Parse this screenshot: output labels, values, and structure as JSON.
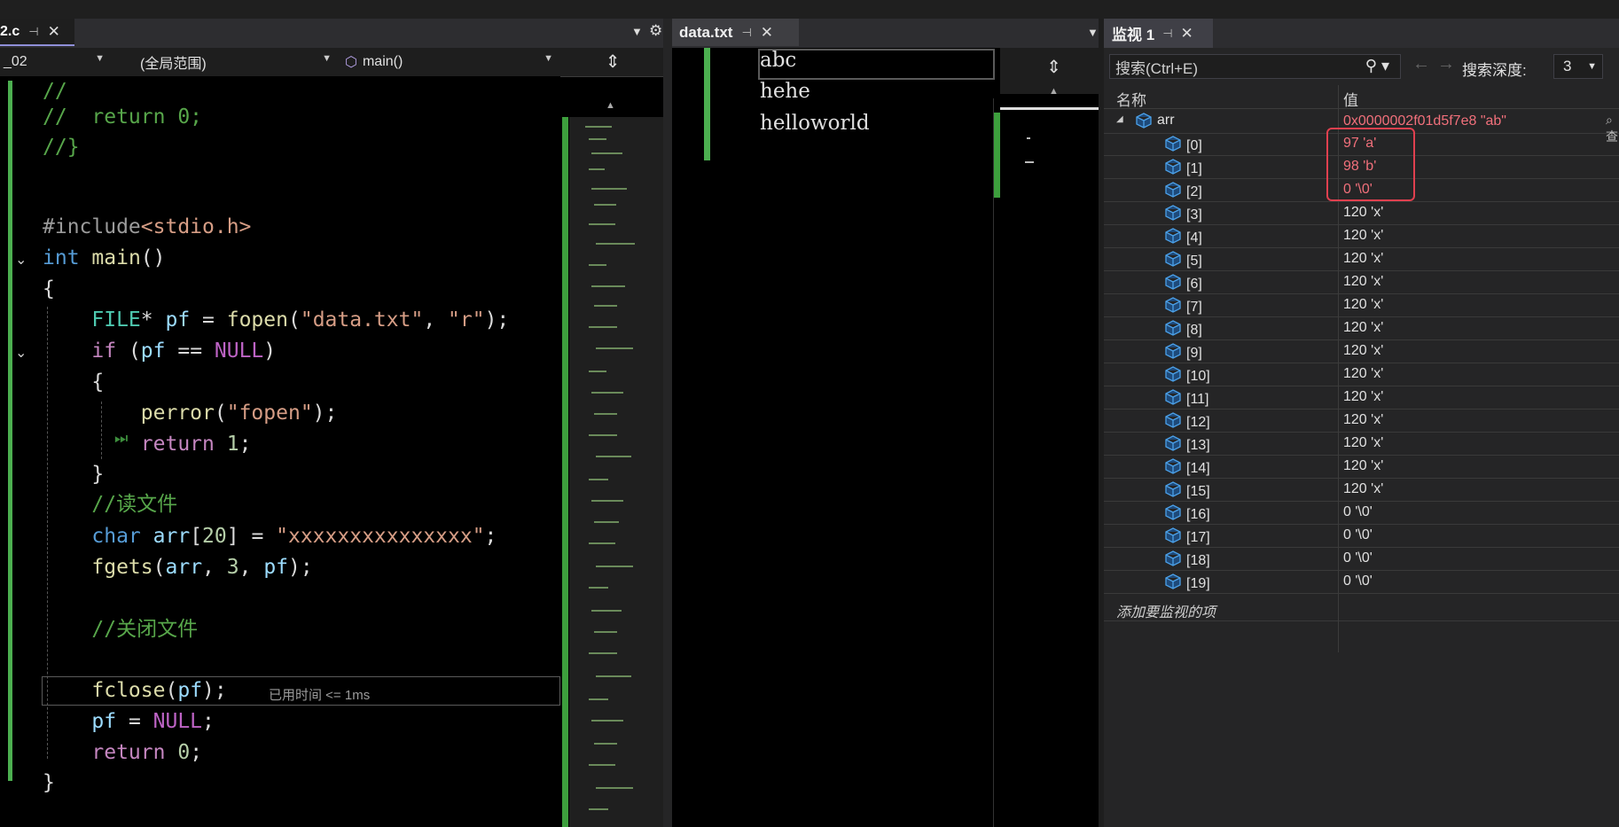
{
  "editor": {
    "tab_label": "2.c",
    "nav": {
      "project": "_02",
      "scope": "(全局范围)",
      "function": "main()"
    },
    "perf_tip": "已用时间 <= 1ms"
  },
  "datafile": {
    "tab_label": "data.txt",
    "lines": [
      "abc",
      "hehe",
      "helloworld"
    ]
  },
  "watch": {
    "tab_label": "监视 1",
    "search_placeholder": "搜索(Ctrl+E)",
    "depth_label": "搜索深度:",
    "depth_value": "3",
    "col_name": "名称",
    "col_value": "值",
    "root": {
      "name": "arr",
      "value": "0x0000002f01d5f7e8 \"ab\""
    },
    "items": [
      {
        "name": "[0]",
        "value": "97 'a'",
        "changed": true
      },
      {
        "name": "[1]",
        "value": "98 'b'",
        "changed": true
      },
      {
        "name": "[2]",
        "value": "0 '\\0'",
        "changed": true
      },
      {
        "name": "[3]",
        "value": "120 'x'"
      },
      {
        "name": "[4]",
        "value": "120 'x'"
      },
      {
        "name": "[5]",
        "value": "120 'x'"
      },
      {
        "name": "[6]",
        "value": "120 'x'"
      },
      {
        "name": "[7]",
        "value": "120 'x'"
      },
      {
        "name": "[8]",
        "value": "120 'x'"
      },
      {
        "name": "[9]",
        "value": "120 'x'"
      },
      {
        "name": "[10]",
        "value": "120 'x'"
      },
      {
        "name": "[11]",
        "value": "120 'x'"
      },
      {
        "name": "[12]",
        "value": "120 'x'"
      },
      {
        "name": "[13]",
        "value": "120 'x'"
      },
      {
        "name": "[14]",
        "value": "120 'x'"
      },
      {
        "name": "[15]",
        "value": "120 'x'"
      },
      {
        "name": "[16]",
        "value": "0 '\\0'"
      },
      {
        "name": "[17]",
        "value": "0 '\\0'"
      },
      {
        "name": "[18]",
        "value": "0 '\\0'"
      },
      {
        "name": "[19]",
        "value": "0 '\\0'"
      }
    ],
    "add_item": "添加要监视的项",
    "colors": {
      "changed": "#f1707b",
      "normal": "#e0e0e0",
      "highlight": "#e0404f"
    }
  }
}
